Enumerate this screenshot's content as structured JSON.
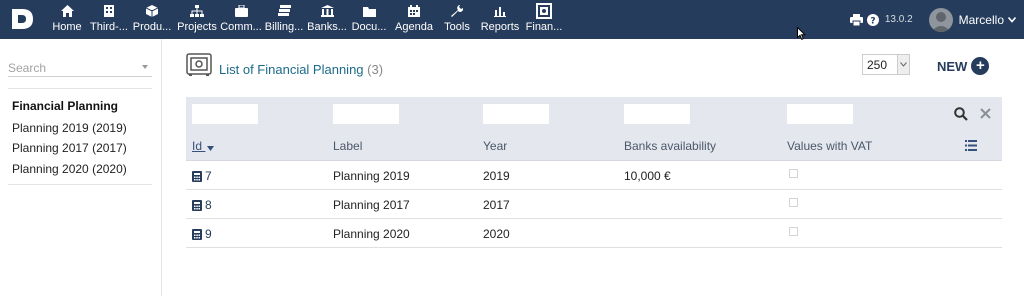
{
  "topbar": {
    "menu": [
      {
        "label": "Home",
        "icon": "home-icon"
      },
      {
        "label": "Third-...",
        "icon": "building-icon"
      },
      {
        "label": "Produ...",
        "icon": "cube-icon"
      },
      {
        "label": "Projects",
        "icon": "sitemap-icon"
      },
      {
        "label": "Comm...",
        "icon": "briefcase-icon"
      },
      {
        "label": "Billing...",
        "icon": "money-icon"
      },
      {
        "label": "Banks...",
        "icon": "bank-icon"
      },
      {
        "label": "Docu...",
        "icon": "folder-icon"
      },
      {
        "label": "Agenda",
        "icon": "calendar-icon"
      },
      {
        "label": "Tools",
        "icon": "wrench-icon"
      },
      {
        "label": "Reports",
        "icon": "chart-icon"
      },
      {
        "label": "Finan...",
        "icon": "safe-icon",
        "active": true
      }
    ],
    "version": "13.0.2",
    "username": "Marcello"
  },
  "sidebar": {
    "search_placeholder": "Search",
    "section_title": "Financial Planning",
    "links": [
      "Planning 2019 (2019)",
      "Planning 2017 (2017)",
      "Planning 2020 (2020)"
    ]
  },
  "list": {
    "title": "List of Financial Planning",
    "count": "(3)",
    "limit": "250",
    "new_label": "NEW"
  },
  "table": {
    "columns": [
      "Id",
      "Label",
      "Year",
      "Banks availability",
      "Values with VAT"
    ],
    "rows": [
      {
        "id": "7",
        "label": "Planning 2019",
        "year": "2019",
        "banks": "10,000 €",
        "vat": false
      },
      {
        "id": "8",
        "label": "Planning 2017",
        "year": "2017",
        "banks": "",
        "vat": false
      },
      {
        "id": "9",
        "label": "Planning 2020",
        "year": "2020",
        "banks": "",
        "vat": false
      }
    ]
  },
  "colors": {
    "topbar": "#263c5c",
    "link": "#1d6b8a",
    "table_header": "#e5e7ef"
  }
}
